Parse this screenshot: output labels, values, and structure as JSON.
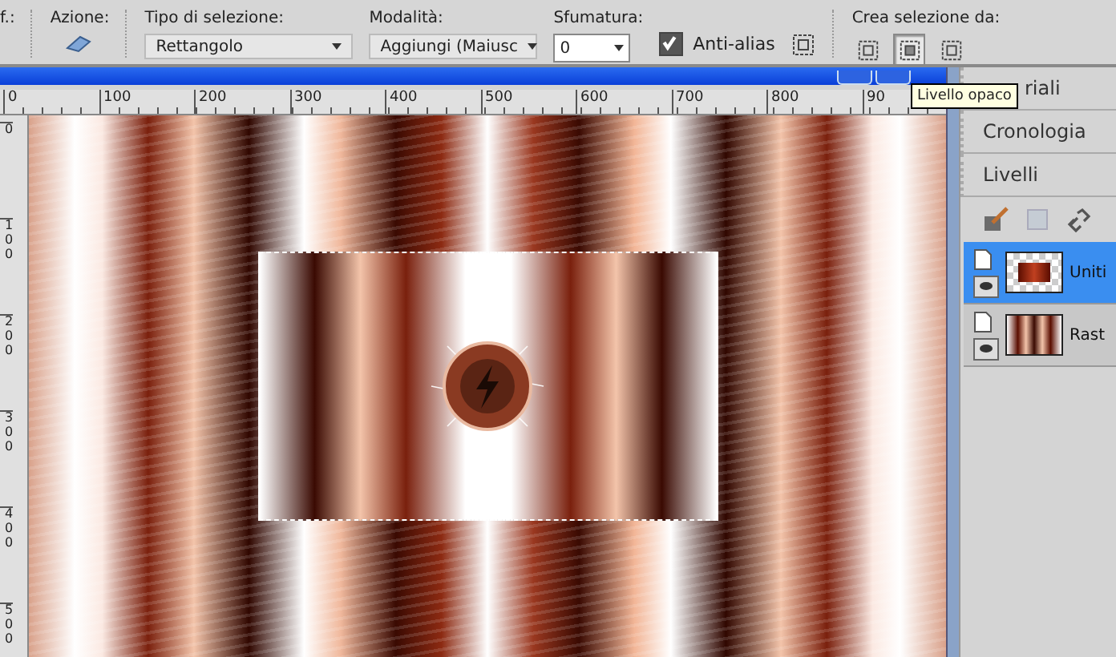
{
  "toolbar": {
    "cut_label": "f.:",
    "action_label": "Azione:",
    "selection_type": {
      "label": "Tipo di selezione:",
      "value": "Rettangolo"
    },
    "mode": {
      "label": "Modalità:",
      "value": "Aggiungi (Maiusc"
    },
    "feather": {
      "label": "Sfumatura:",
      "value": "0"
    },
    "anti_alias": {
      "label": "Anti-alias",
      "checked": true
    },
    "create_from": {
      "label": "Crea selezione da:",
      "buttons": [
        {
          "selected": false
        },
        {
          "selected": true
        },
        {
          "selected": false
        }
      ]
    }
  },
  "tooltip": "Livello opaco",
  "ruler": {
    "horizontal": [
      "0",
      "100",
      "200",
      "300",
      "400",
      "500",
      "600",
      "700",
      "800",
      "90"
    ],
    "vertical": [
      "0",
      "100",
      "200",
      "300",
      "400",
      "500"
    ]
  },
  "panels": [
    {
      "label": "riali"
    },
    {
      "label": "Cronologia"
    },
    {
      "label": "Livelli"
    }
  ],
  "layers": [
    {
      "name": "Uniti",
      "selected": true,
      "visible": true,
      "kind": "selection"
    },
    {
      "name": "Rast",
      "selected": false,
      "visible": true,
      "kind": "raster"
    }
  ]
}
